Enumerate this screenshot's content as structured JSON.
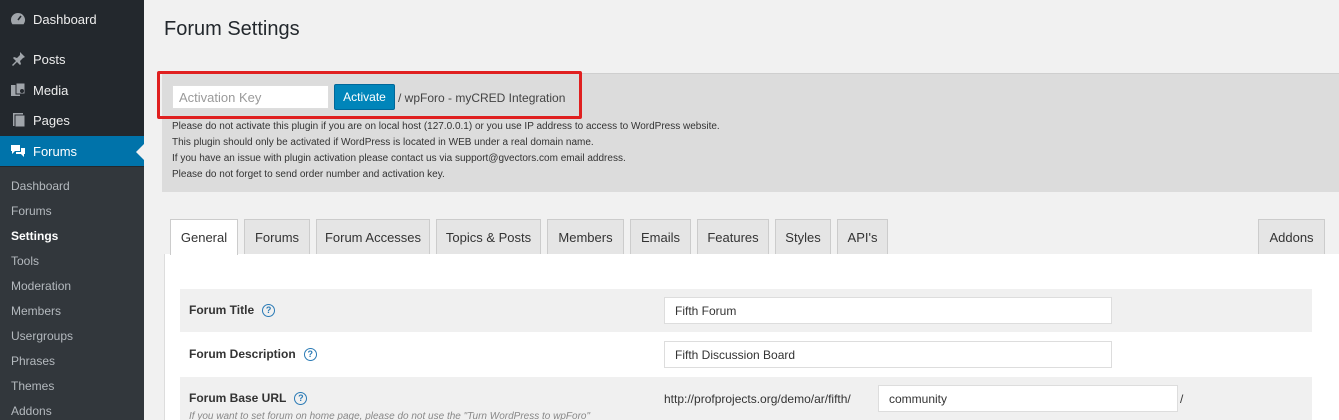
{
  "sidebar": {
    "top_items": [
      {
        "label": "Dashboard",
        "icon": "dashboard-icon"
      },
      {
        "label": "Posts",
        "icon": "pin-icon"
      },
      {
        "label": "Media",
        "icon": "media-icon"
      },
      {
        "label": "Pages",
        "icon": "pages-icon"
      },
      {
        "label": "Forums",
        "icon": "forums-icon",
        "current": true
      }
    ],
    "submenu": [
      "Dashboard",
      "Forums",
      "Settings",
      "Tools",
      "Moderation",
      "Members",
      "Usergroups",
      "Phrases",
      "Themes",
      "Addons"
    ],
    "active_submenu": "Settings"
  },
  "page": {
    "title": "Forum Settings"
  },
  "activation": {
    "input_placeholder": "Activation Key",
    "button_label": "Activate",
    "addon_name": "/ wpForo - myCRED Integration",
    "notices": [
      "Please do not activate this plugin if you are on local host (127.0.0.1) or you use IP address to access to WordPress website.",
      "This plugin should only be activated if WordPress is located in WEB under a real domain name.",
      "If you have an issue with plugin activation please contact us via support@gvectors.com email address.",
      "Please do not forget to send order number and activation key."
    ]
  },
  "tabs": [
    "General",
    "Forums",
    "Forum Accesses",
    "Topics & Posts",
    "Members",
    "Emails",
    "Features",
    "Styles",
    "API's",
    "Addons"
  ],
  "active_tab": "General",
  "settings": {
    "forum_title": {
      "label": "Forum Title",
      "value": "Fifth Forum"
    },
    "forum_description": {
      "label": "Forum Description",
      "value": "Fifth Discussion Board"
    },
    "forum_base_url": {
      "label": "Forum Base URL",
      "prefix": "http://profprojects.org/demo/ar/fifth/",
      "value": "community",
      "suffix": "/",
      "description": "If you want to set forum on home page, please do not use the \"Turn WordPress to wpForo\""
    }
  },
  "colors": {
    "sidebar_bg": "#23282d",
    "submenu_bg": "#32373c",
    "accent": "#0073aa",
    "highlight_border": "#e02020"
  }
}
